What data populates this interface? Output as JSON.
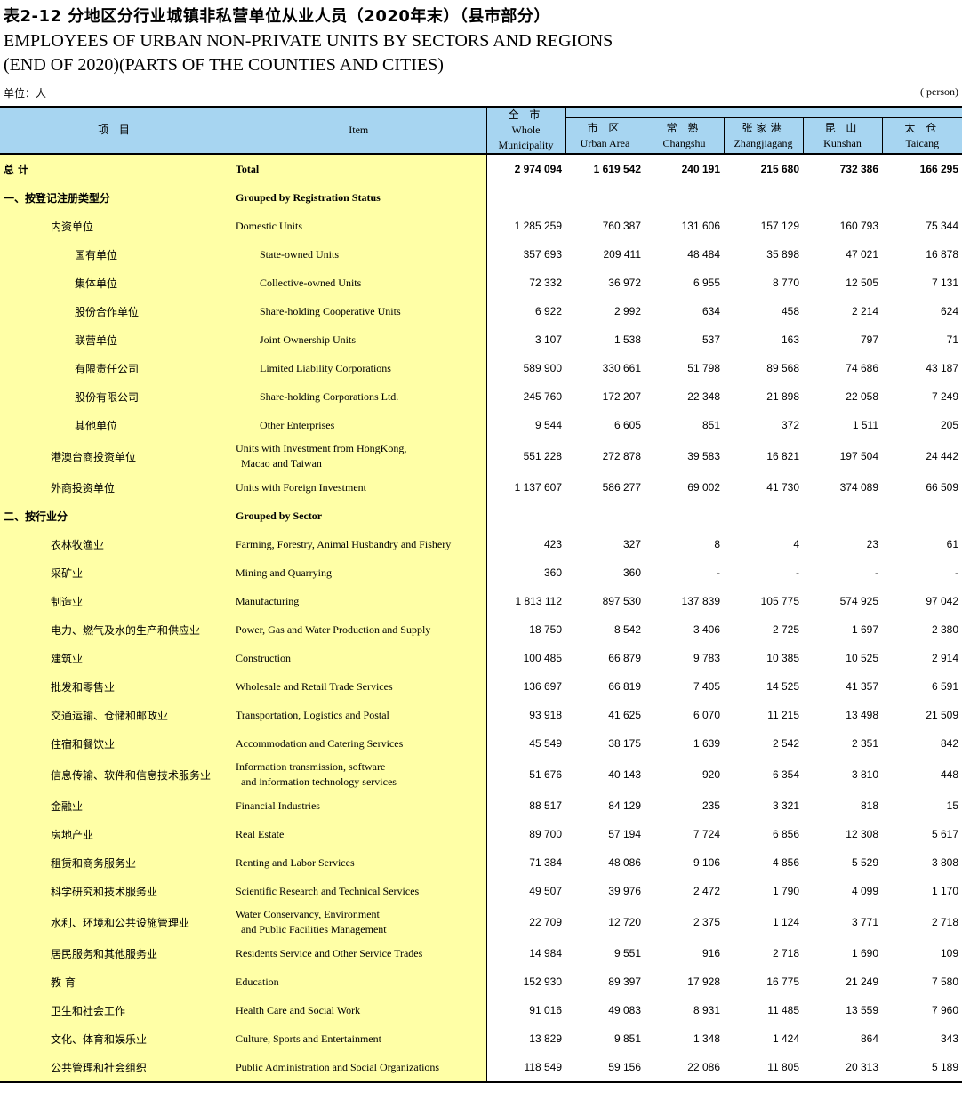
{
  "title": {
    "cn": "表2-12  分地区分行业城镇非私营单位从业人员（2020年末）（县市部分）",
    "en_line1": "EMPLOYEES OF URBAN NON-PRIVATE UNITS BY SECTORS AND REGIONS",
    "en_line2": "(END OF 2020)(PARTS OF THE COUNTIES AND CITIES)"
  },
  "unit": {
    "cn": "单位：人",
    "en": "( person)"
  },
  "header": {
    "item_cn": "项    目",
    "item_en": "Item",
    "whole_cn": "全  市",
    "whole_en1": "Whole",
    "whole_en2": "Municipality",
    "regions": [
      {
        "cn": "市  区",
        "en": "Urban Area"
      },
      {
        "cn": "常  熟",
        "en": "Changshu"
      },
      {
        "cn": "张家港",
        "en": "Zhangjiagang"
      },
      {
        "cn": "昆  山",
        "en": "Kunshan"
      },
      {
        "cn": "太  仓",
        "en": "Taicang"
      }
    ]
  },
  "rows": [
    {
      "cn": "总    计",
      "en": "Total",
      "level": 0,
      "bold": true,
      "values": [
        "2 974 094",
        "1 619 542",
        "240 191",
        "215 680",
        "732 386",
        "166 295"
      ]
    },
    {
      "cn": "一、按登记注册类型分",
      "en": "Grouped by Registration Status",
      "level": 0,
      "bold": true,
      "values": [
        "",
        "",
        "",
        "",
        "",
        ""
      ]
    },
    {
      "cn": "内资单位",
      "en": "Domestic Units",
      "level": 1,
      "values": [
        "1 285 259",
        "760 387",
        "131 606",
        "157 129",
        "160 793",
        "75 344"
      ]
    },
    {
      "cn": "国有单位",
      "en": "State-owned Units",
      "level": 2,
      "values": [
        "357 693",
        "209 411",
        "48 484",
        "35 898",
        "47 021",
        "16 878"
      ]
    },
    {
      "cn": "集体单位",
      "en": "Collective-owned Units",
      "level": 2,
      "values": [
        "72 332",
        "36 972",
        "6 955",
        "8 770",
        "12 505",
        "7 131"
      ]
    },
    {
      "cn": "股份合作单位",
      "en": "Share-holding Cooperative Units",
      "level": 2,
      "values": [
        "6 922",
        "2 992",
        "634",
        "458",
        "2 214",
        "624"
      ]
    },
    {
      "cn": "联营单位",
      "en": "Joint Ownership Units",
      "level": 2,
      "values": [
        "3 107",
        "1 538",
        "537",
        "163",
        "797",
        "71"
      ]
    },
    {
      "cn": "有限责任公司",
      "en": "Limited Liability Corporations",
      "level": 2,
      "values": [
        "589 900",
        "330 661",
        "51 798",
        "89 568",
        "74 686",
        "43 187"
      ]
    },
    {
      "cn": "股份有限公司",
      "en": "Share-holding Corporations Ltd.",
      "level": 2,
      "values": [
        "245 760",
        "172 207",
        "22 348",
        "21 898",
        "22 058",
        "7 249"
      ]
    },
    {
      "cn": "其他单位",
      "en": "Other Enterprises",
      "level": 2,
      "values": [
        "9 544",
        "6 605",
        "851",
        "372",
        "1 511",
        "205"
      ]
    },
    {
      "cn": "港澳台商投资单位",
      "en": "Units with Investment from HongKong,",
      "en2": " Macao and Taiwan",
      "level": 1,
      "tall": true,
      "values": [
        "551 228",
        "272 878",
        "39 583",
        "16 821",
        "197 504",
        "24 442"
      ]
    },
    {
      "cn": "外商投资单位",
      "en": "Units with Foreign Investment",
      "level": 1,
      "values": [
        "1 137 607",
        "586 277",
        "69 002",
        "41 730",
        "374 089",
        "66 509"
      ]
    },
    {
      "cn": "二、按行业分",
      "en": "Grouped by Sector",
      "level": 0,
      "bold": true,
      "values": [
        "",
        "",
        "",
        "",
        "",
        ""
      ]
    },
    {
      "cn": "农林牧渔业",
      "en": "Farming, Forestry, Animal Husbandry and Fishery",
      "level": 1,
      "values": [
        "423",
        "327",
        "8",
        "4",
        "23",
        "61"
      ]
    },
    {
      "cn": "采矿业",
      "en": "Mining and Quarrying",
      "level": 1,
      "values": [
        "360",
        "360",
        "-",
        "-",
        "-",
        "-"
      ]
    },
    {
      "cn": "制造业",
      "en": "Manufacturing",
      "level": 1,
      "values": [
        "1 813 112",
        "897 530",
        "137 839",
        "105 775",
        "574 925",
        "97 042"
      ]
    },
    {
      "cn": "电力、燃气及水的生产和供应业",
      "en": "Power, Gas and Water Production and Supply",
      "level": 1,
      "values": [
        "18 750",
        "8 542",
        "3 406",
        "2 725",
        "1 697",
        "2 380"
      ]
    },
    {
      "cn": "建筑业",
      "en": "Construction",
      "level": 1,
      "values": [
        "100 485",
        "66 879",
        "9 783",
        "10 385",
        "10 525",
        "2 914"
      ]
    },
    {
      "cn": "批发和零售业",
      "en": "Wholesale and Retail Trade Services",
      "level": 1,
      "values": [
        "136 697",
        "66 819",
        "7 405",
        "14 525",
        "41 357",
        "6 591"
      ]
    },
    {
      "cn": "交通运输、仓储和邮政业",
      "en": "Transportation, Logistics and Postal",
      "level": 1,
      "values": [
        "93 918",
        "41 625",
        "6 070",
        "11 215",
        "13 498",
        "21 509"
      ]
    },
    {
      "cn": "住宿和餐饮业",
      "en": "Accommodation  and Catering Services",
      "level": 1,
      "values": [
        "45 549",
        "38 175",
        "1 639",
        "2 542",
        "2 351",
        "842"
      ]
    },
    {
      "cn": "信息传输、软件和信息技术服务业",
      "en": "Information transmission, software",
      "en2": " and information technology services",
      "level": 1,
      "tall": true,
      "values": [
        "51 676",
        "40 143",
        "920",
        "6 354",
        "3 810",
        "448"
      ]
    },
    {
      "cn": "金融业",
      "en": "Financial Industries",
      "level": 1,
      "values": [
        "88 517",
        "84 129",
        "235",
        "3 321",
        "818",
        "15"
      ]
    },
    {
      "cn": "房地产业",
      "en": "Real Estate",
      "level": 1,
      "values": [
        "89 700",
        "57 194",
        "7 724",
        "6 856",
        "12 308",
        "5 617"
      ]
    },
    {
      "cn": "租赁和商务服务业",
      "en": "Renting and Labor Services",
      "level": 1,
      "values": [
        "71 384",
        "48 086",
        "9 106",
        "4 856",
        "5 529",
        "3 808"
      ]
    },
    {
      "cn": "科学研究和技术服务业",
      "en": "Scientific Research and Technical Services",
      "level": 1,
      "values": [
        "49 507",
        "39 976",
        "2 472",
        "1 790",
        "4 099",
        "1 170"
      ]
    },
    {
      "cn": "水利、环境和公共设施管理业",
      "en": "Water Conservancy, Environment",
      "en2": " and Public Facilities Management",
      "level": 1,
      "tall": true,
      "values": [
        "22 709",
        "12 720",
        "2 375",
        "1 124",
        "3 771",
        "2 718"
      ]
    },
    {
      "cn": "居民服务和其他服务业",
      "en": "Residents Service and Other Service Trades",
      "level": 1,
      "values": [
        "14 984",
        "9 551",
        "916",
        "2 718",
        "1 690",
        "109"
      ]
    },
    {
      "cn": "教  育",
      "en": "Education",
      "level": 1,
      "values": [
        "152 930",
        "89 397",
        "17 928",
        "16 775",
        "21 249",
        "7 580"
      ]
    },
    {
      "cn": "卫生和社会工作",
      "en": "Health Care and Social Work",
      "level": 1,
      "values": [
        "91 016",
        "49 083",
        "8 931",
        "11 485",
        "13 559",
        "7 960"
      ]
    },
    {
      "cn": "文化、体育和娱乐业",
      "en": "Culture, Sports and Entertainment",
      "level": 1,
      "values": [
        "13 829",
        "9 851",
        "1 348",
        "1 424",
        "864",
        "343"
      ]
    },
    {
      "cn": "公共管理和社会组织",
      "en": "Public Administration and Social Organizations",
      "level": 1,
      "values": [
        "118 549",
        "59 156",
        "22 086",
        "11 805",
        "20 313",
        "5 189"
      ]
    }
  ]
}
